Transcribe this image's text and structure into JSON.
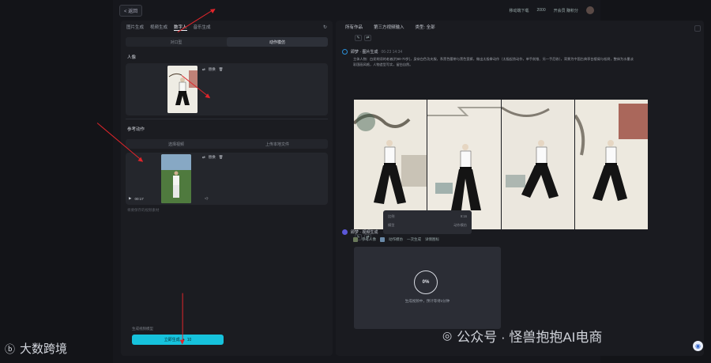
{
  "topbar": {
    "back_label": "< 返回",
    "right_items": [
      "移动端下载",
      "2000",
      "开会员 赚积分"
    ]
  },
  "left": {
    "tabs": [
      "图片生成",
      "视频生成",
      "数字人",
      "音乐生成"
    ],
    "active_tab": "数字人",
    "modes": [
      "对口型",
      "动作模仿"
    ],
    "sections": {
      "person": "人像",
      "action": "参考动作"
    },
    "buttons": {
      "replace": "替换",
      "upload_video": "选择视频",
      "upload_local": "上传本地文件"
    },
    "hint": "将要保存的视频素材",
    "duration": "00:17",
    "model": "生成视频模型",
    "generate_label": "立即生成",
    "generate_cost": "10"
  },
  "right": {
    "tabs": [
      "所有作品",
      "第三方视频输入",
      "类型: 全部"
    ],
    "msg1_head": "即梦 · 图片生成",
    "msg1_time": "06-23 14:34",
    "msg1_text": "主体人物：白发胡须的老者(约60-70岁)，身穿白色功夫服，系黑色腰带与黑色宽裤，做出太极拳动作（太极起势动作，单手前推、另一手后收），背景为中国古典亭台楼阁与松树，整体为水墨淡彩国画风格，人物造型写实，留白自然。",
    "popup": [
      {
        "k": "比例",
        "v": "9:16"
      },
      {
        "k": "模型",
        "v": "动作模仿"
      }
    ],
    "msg2_head": "即梦 · 视频生成",
    "msg2_tags": [
      "参考人像",
      "动作模仿",
      "一次生成",
      "详情图标"
    ],
    "progress": "0%",
    "progress_text": "生成视频中，预计等待2分钟"
  },
  "watermark": "公众号 · 怪兽抱抱AI电商",
  "logo": "大数跨境",
  "colors": {
    "accent": "#16c2dc",
    "arrow": "#e0252b"
  }
}
